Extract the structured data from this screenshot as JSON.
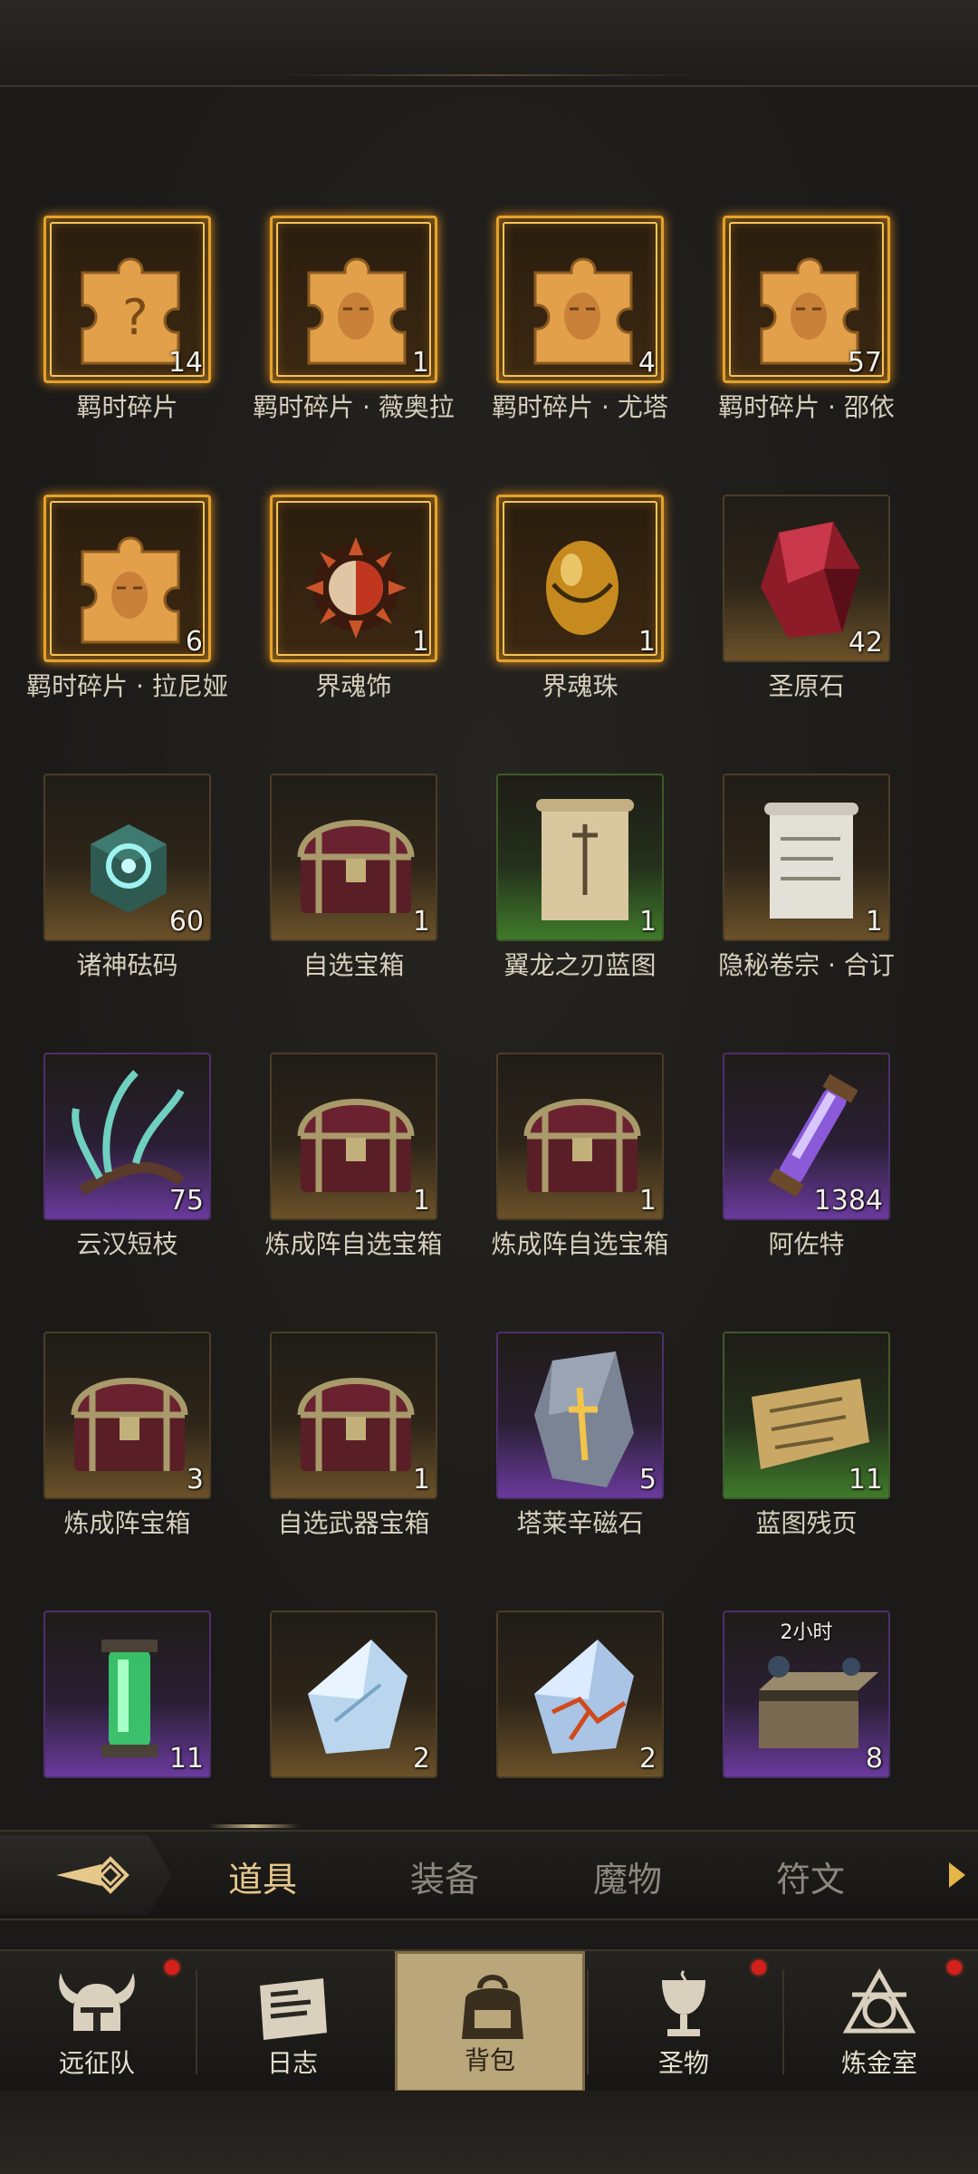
{
  "inventory": {
    "items": [
      {
        "name": "羁时碎片",
        "qty": "14",
        "rarity": "legend",
        "icon": "puzzle-piece-question-icon"
      },
      {
        "name": "羁时碎片 · 薇奥拉",
        "qty": "1",
        "rarity": "legend",
        "icon": "puzzle-piece-portrait-icon"
      },
      {
        "name": "羁时碎片 · 尤塔",
        "qty": "4",
        "rarity": "legend",
        "icon": "puzzle-piece-portrait-icon"
      },
      {
        "name": "羁时碎片 · 邵依",
        "qty": "57",
        "rarity": "legend",
        "icon": "puzzle-piece-portrait-icon"
      },
      {
        "name": "羁时碎片 · 拉尼娅",
        "qty": "6",
        "rarity": "legend",
        "icon": "puzzle-piece-portrait-icon"
      },
      {
        "name": "界魂饰",
        "qty": "1",
        "rarity": "legend",
        "icon": "sun-mask-ornament-icon"
      },
      {
        "name": "界魂珠",
        "qty": "1",
        "rarity": "legend",
        "icon": "golden-orb-icon"
      },
      {
        "name": "圣原石",
        "qty": "42",
        "rarity": "gold",
        "icon": "red-crystal-icon"
      },
      {
        "name": "诸神砝码",
        "qty": "60",
        "rarity": "gold",
        "icon": "rune-cube-icon"
      },
      {
        "name": "自选宝箱",
        "qty": "1",
        "rarity": "gold",
        "icon": "treasure-chest-icon"
      },
      {
        "name": "翼龙之刃蓝图",
        "qty": "1",
        "rarity": "green",
        "icon": "blueprint-scroll-icon"
      },
      {
        "name": "隐秘卷宗 · 合订",
        "qty": "1",
        "rarity": "gold",
        "icon": "paper-scroll-icon"
      },
      {
        "name": "云汉短枝",
        "qty": "75",
        "rarity": "purple",
        "icon": "crystal-branch-icon"
      },
      {
        "name": "炼成阵自选宝箱",
        "qty": "1",
        "rarity": "gold",
        "icon": "treasure-chest-icon"
      },
      {
        "name": "炼成阵自选宝箱",
        "qty": "1",
        "rarity": "gold",
        "icon": "treasure-chest-icon"
      },
      {
        "name": "阿佐特",
        "qty": "1384",
        "rarity": "purple",
        "icon": "potion-vial-icon"
      },
      {
        "name": "炼成阵宝箱",
        "qty": "3",
        "rarity": "gold",
        "icon": "treasure-chest-icon"
      },
      {
        "name": "自选武器宝箱",
        "qty": "1",
        "rarity": "gold",
        "icon": "treasure-chest-icon"
      },
      {
        "name": "塔莱辛磁石",
        "qty": "5",
        "rarity": "purple",
        "icon": "runestone-icon"
      },
      {
        "name": "蓝图残页",
        "qty": "11",
        "rarity": "green",
        "icon": "torn-page-icon"
      },
      {
        "name": "",
        "qty": "11",
        "rarity": "purple",
        "icon": "green-lantern-icon"
      },
      {
        "name": "",
        "qty": "2",
        "rarity": "gold",
        "icon": "ice-shard-icon"
      },
      {
        "name": "",
        "qty": "2",
        "rarity": "gold",
        "icon": "cracked-ice-shard-icon"
      },
      {
        "name": "",
        "qty": "8",
        "rarity": "purple",
        "icon": "supply-crate-icon",
        "timer": "2小时"
      }
    ]
  },
  "tabs": {
    "items": [
      "道具",
      "装备",
      "魔物",
      "符文"
    ],
    "active": "道具"
  },
  "nav": {
    "items": [
      {
        "label": "远征队",
        "icon": "horned-helmet-icon",
        "badge": true
      },
      {
        "label": "日志",
        "icon": "journal-icon",
        "badge": false
      },
      {
        "label": "背包",
        "icon": "backpack-icon",
        "badge": false,
        "active": true
      },
      {
        "label": "圣物",
        "icon": "chalice-icon",
        "badge": true
      },
      {
        "label": "炼金室",
        "icon": "alchemy-sigil-icon",
        "badge": true
      }
    ]
  },
  "colors": {
    "legend_border": "#e5a22a",
    "active_tab": "#e7c88b",
    "badge": "#d3201a"
  }
}
